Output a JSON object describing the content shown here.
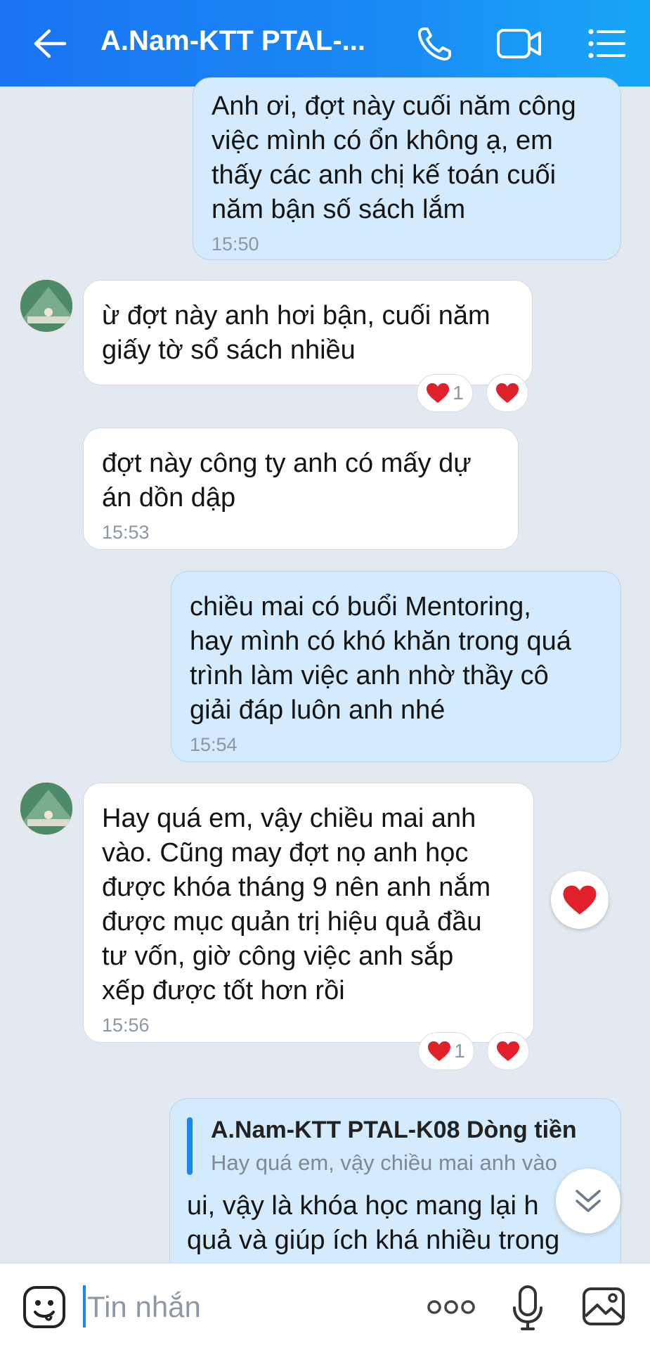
{
  "header": {
    "title": "A.Nam-KTT PTAL-...",
    "icons": [
      "back-arrow-icon",
      "phone-icon",
      "video-camera-icon",
      "list-menu-icon"
    ]
  },
  "messages": [
    {
      "direction": "outgoing",
      "text": "Anh ơi, đợt này cuối năm công việc mình có ổn không ạ, em thấy các anh chị kế toán cuối năm bận sổ sách lắm",
      "lines": [
        "Anh ơi, đợt này cuối năm công",
        "việc mình có ổn không ạ, em",
        "thấy các anh chị kế toán cuối",
        "năm bận số sách lắm"
      ],
      "time": "15:50"
    },
    {
      "direction": "incoming",
      "lines": [
        "ừ đợt này anh hơi bận, cuối năm",
        "giấy tờ sổ sách nhiều"
      ],
      "reactions": {
        "heart_count": "1"
      }
    },
    {
      "direction": "incoming",
      "lines": [
        "đợt này công ty anh có mấy dự",
        "án dồn dập"
      ],
      "time": "15:53"
    },
    {
      "direction": "outgoing",
      "lines": [
        "chiều mai có buổi Mentoring,",
        "hay mình có khó khăn trong quá",
        "trình làm việc anh nhờ thầy cô",
        "giải đáp luôn anh nhé"
      ],
      "time": "15:54"
    },
    {
      "direction": "incoming",
      "lines": [
        "Hay quá em, vậy chiều mai anh",
        "vào. Cũng may đợt nọ anh học",
        "được khóa tháng 9 nên anh nắm",
        "được mục quản trị hiệu quả đầu",
        "tư vốn, giờ công việc anh sắp",
        "xếp được tốt hơn rồi"
      ],
      "time": "15:56",
      "reactions": {
        "heart_count": "1"
      }
    },
    {
      "direction": "outgoing",
      "quote": {
        "author": "A.Nam-KTT PTAL-K08 Dòng tiền",
        "text": "Hay quá em, vậy chiều mai anh vào"
      },
      "lines": [
        "ui, vậy là khóa học mang lại h",
        "quả và giúp ích khá nhiều trong"
      ]
    }
  ],
  "composer": {
    "placeholder": "Tin nhắn",
    "icons": [
      "sticker-icon",
      "more-options-icon",
      "microphone-icon",
      "image-icon"
    ]
  },
  "colors": {
    "header_start": "#1a73f2",
    "header_end": "#18a7f7",
    "outgoing_bubble": "#d3ebfd",
    "incoming_bubble": "#ffffff",
    "background": "#e2e9f1",
    "heart": "#e0202b",
    "accent": "#1a86f0"
  }
}
